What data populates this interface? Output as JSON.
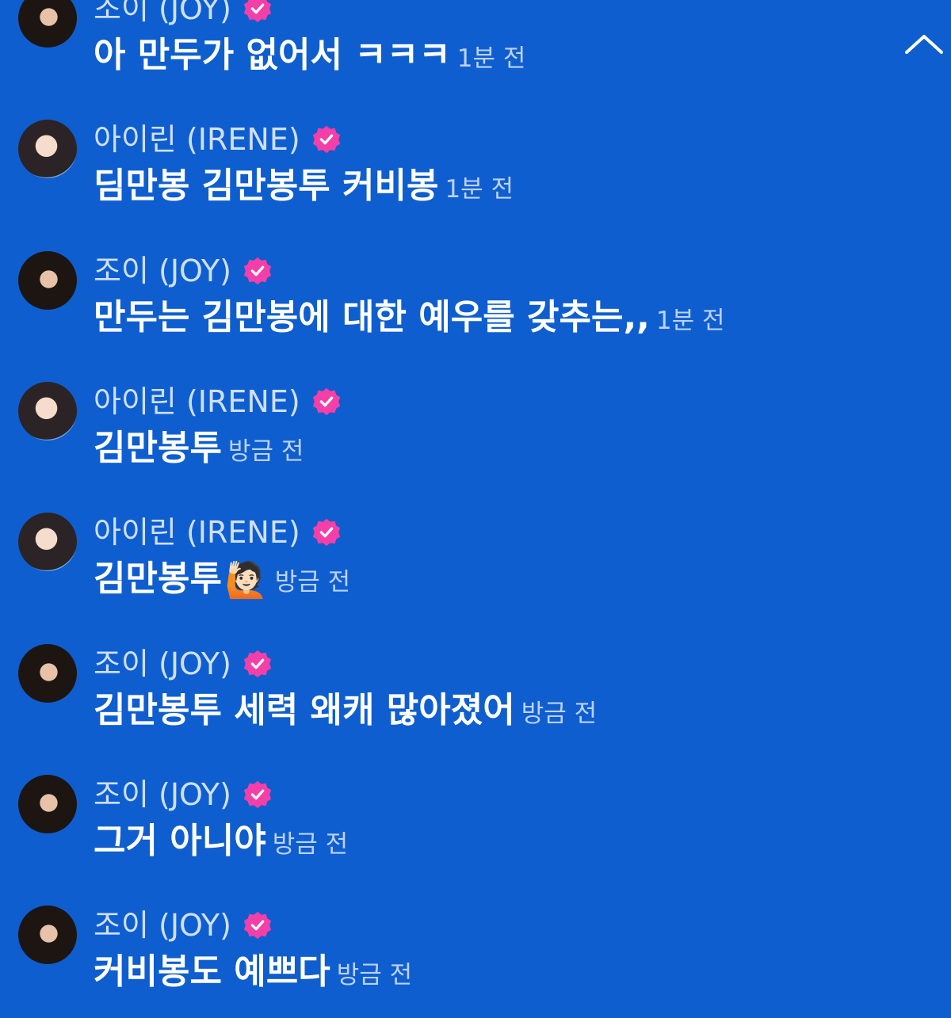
{
  "messages": [
    {
      "author": "조이 (JOY)",
      "text": "아 만두가 없어서 ㅋㅋㅋ",
      "time": "1분 전",
      "avatar": "joy-avatar"
    },
    {
      "author": "아이린 (IRENE)",
      "text": "딤만봉 김만봉투 커비봉",
      "time": "1분 전",
      "avatar": "irene-avatar"
    },
    {
      "author": "조이 (JOY)",
      "text": "만두는 김만봉에 대한 예우를 갖추는,,",
      "time": "1분 전",
      "avatar": "joy-avatar"
    },
    {
      "author": "아이린 (IRENE)",
      "text": "김만봉투",
      "time": "방금 전",
      "avatar": "irene-avatar"
    },
    {
      "author": "아이린 (IRENE)",
      "text": "김만봉투",
      "emoji": "🙋🏻",
      "time": "방금 전",
      "avatar": "irene-avatar"
    },
    {
      "author": "조이 (JOY)",
      "text": "김만봉투 세력 왜캐 많아졌어",
      "time": "방금 전",
      "avatar": "joy-avatar"
    },
    {
      "author": "조이 (JOY)",
      "text": "그거 아니야",
      "time": "방금 전",
      "avatar": "joy-avatar"
    },
    {
      "author": "조이 (JOY)",
      "text": "커비봉도 예쁘다",
      "time": "방금 전",
      "avatar": "joy-avatar"
    }
  ],
  "icons": {
    "verified": "verified-badge-icon",
    "collapse": "chevron-up-icon"
  },
  "colors": {
    "background": "#0f5ecf",
    "badge": "#f43fa8",
    "text": "#ffffff",
    "time": "#bcd1f7"
  }
}
